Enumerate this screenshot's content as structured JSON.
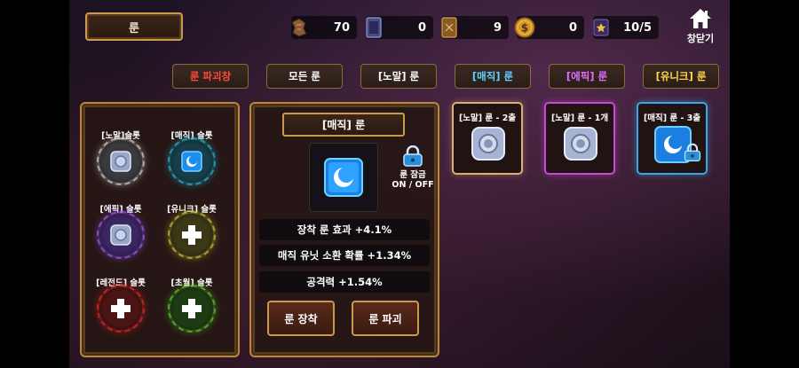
{
  "header": {
    "title": "룬",
    "home_label": "창닫기"
  },
  "resources": [
    {
      "icon": "rune-shard-icon",
      "value": "70"
    },
    {
      "icon": "card-pack-icon",
      "value": "0"
    },
    {
      "icon": "scroll-card-icon",
      "value": "9"
    },
    {
      "icon": "gold-coin-icon",
      "value": "0"
    },
    {
      "icon": "star-ticket-icon",
      "value": "10/5"
    }
  ],
  "tabs": [
    {
      "label": "룬 파괴창",
      "color": "#ff4a3a"
    },
    {
      "label": "모든 룬",
      "color": "#ffffff"
    },
    {
      "label": "[노말] 룬",
      "color": "#ffffff"
    },
    {
      "label": "[매직] 룬",
      "color": "#5fd3ff"
    },
    {
      "label": "[에픽] 룬",
      "color": "#e46bff"
    },
    {
      "label": "[유니크] 룬",
      "color": "#ffd84a"
    }
  ],
  "slots": [
    {
      "label": "[노말]슬롯",
      "ring_color": "#cfcfcf",
      "content": "rune"
    },
    {
      "label": "[매직] 슬롯",
      "ring_color": "#23b8d6",
      "content": "rune"
    },
    {
      "label": "[에픽] 슬롯",
      "ring_color": "#a05cf0",
      "content": "rune"
    },
    {
      "label": "[유니크] 슬롯",
      "ring_color": "#c8c23a",
      "content": "add"
    },
    {
      "label": "[레전드] 슬롯",
      "ring_color": "#e0282a",
      "content": "add"
    },
    {
      "label": "[초월] 슬롯",
      "ring_color": "#5fc832",
      "content": "add"
    }
  ],
  "detail": {
    "name": "[매직] 룬",
    "lock_label": "룬 잠금",
    "lock_toggle": "ON / OFF",
    "stats": [
      "장착 룬 효과 +4.1%",
      "매직 유닛 소환 확률 +1.34%",
      "공격력 +1.54%"
    ],
    "equip_button": "룬 장착",
    "destroy_button": "룬 파괴"
  },
  "inventory": [
    {
      "label": "[노말] 룬 - 2출",
      "frame_color": "#d9b070",
      "rarity": "normal",
      "locked": false
    },
    {
      "label": "[노말] 룬 - 1개",
      "frame_color": "#c948d8",
      "rarity": "normal",
      "locked": false
    },
    {
      "label": "[매직] 룬 - 3출",
      "frame_color": "#3aa6e8",
      "rarity": "magic",
      "locked": true
    }
  ]
}
